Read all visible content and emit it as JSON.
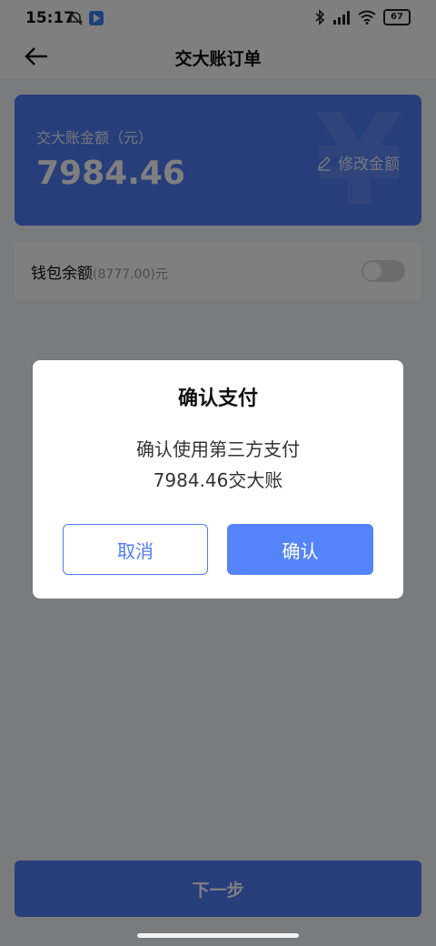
{
  "status_bar": {
    "time": "15:17",
    "battery": "67",
    "icons": [
      "alarm-off-icon",
      "play-store-icon",
      "bluetooth-icon",
      "signal-icon",
      "wifi-icon",
      "battery-icon"
    ]
  },
  "header": {
    "title": "交大账订单",
    "back_icon": "arrow-left-icon"
  },
  "amount_card": {
    "label": "交大账金额（元）",
    "amount": "7984.46",
    "edit_label": "修改金额",
    "edit_icon": "pencil-icon",
    "watermark": "¥"
  },
  "wallet": {
    "label": "钱包余额",
    "balance": "(8777.00)",
    "unit": "元",
    "toggle_on": false
  },
  "footer": {
    "next_label": "下一步"
  },
  "dialog": {
    "title": "确认支付",
    "message_line1": "确认使用第三方支付",
    "message_line2": "7984.46交大账",
    "cancel_label": "取消",
    "confirm_label": "确认"
  },
  "colors": {
    "accent": "#4f7cf6",
    "confirm": "#5584fa",
    "overlay": "rgba(0,0,0,0.5)"
  }
}
